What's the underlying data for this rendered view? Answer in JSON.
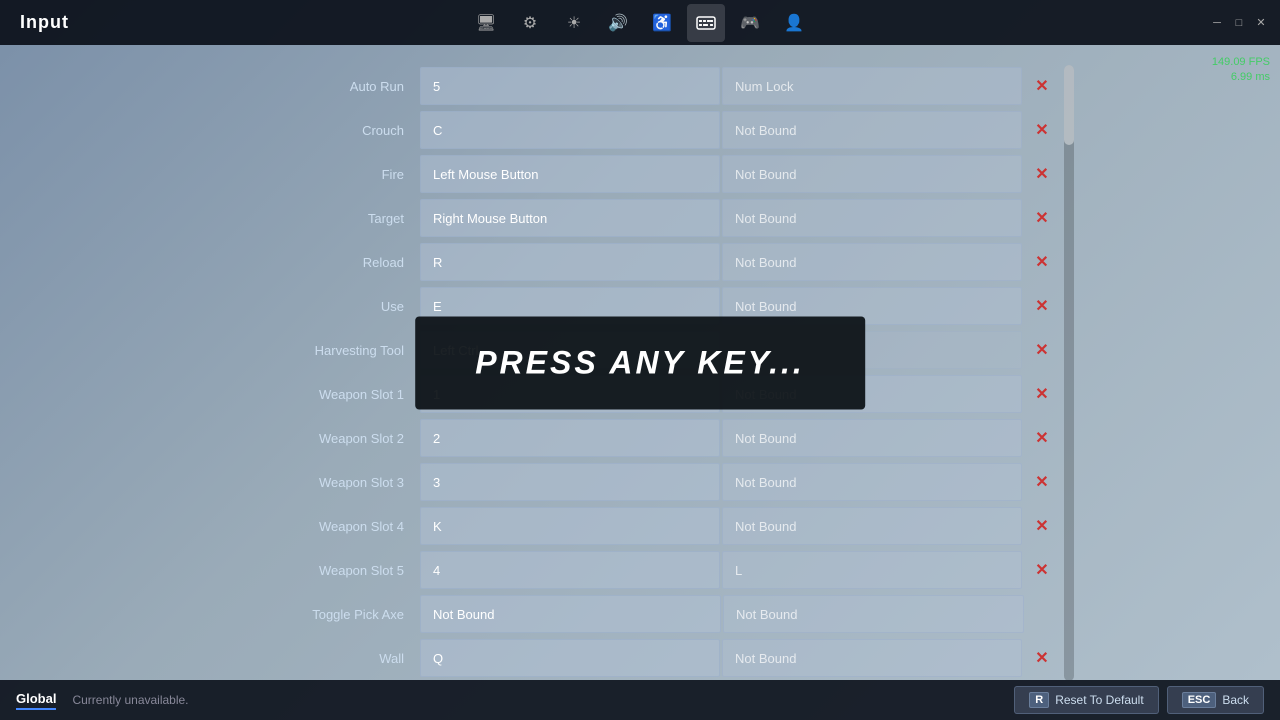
{
  "window": {
    "title": "Input",
    "fps": "149.09 FPS",
    "ms": "6.99 ms"
  },
  "nav_icons": [
    {
      "name": "display-icon",
      "symbol": "🖥",
      "active": false
    },
    {
      "name": "settings-icon",
      "symbol": "⚙",
      "active": false
    },
    {
      "name": "brightness-icon",
      "symbol": "☀",
      "active": false
    },
    {
      "name": "audio-icon",
      "symbol": "🔊",
      "active": false
    },
    {
      "name": "accessibility-icon",
      "symbol": "♿",
      "active": false
    },
    {
      "name": "input-icon",
      "symbol": "⌨",
      "active": true
    },
    {
      "name": "controller-icon",
      "symbol": "🎮",
      "active": false
    },
    {
      "name": "account-icon",
      "symbol": "👤",
      "active": false
    }
  ],
  "bindings": [
    {
      "action": "Auto Run",
      "primary": "5",
      "secondary": "Num Lock",
      "has_delete": true
    },
    {
      "action": "Crouch",
      "primary": "C",
      "secondary": "Not Bound",
      "has_delete": true
    },
    {
      "action": "Fire",
      "primary": "Left Mouse Button",
      "secondary": "Not Bound",
      "has_delete": true
    },
    {
      "action": "Target",
      "primary": "Right Mouse Button",
      "secondary": "Not Bound",
      "has_delete": true
    },
    {
      "action": "Reload",
      "primary": "R",
      "secondary": "Not Bound",
      "has_delete": true
    },
    {
      "action": "Use",
      "primary": "E",
      "secondary": "Not Bound",
      "has_delete": true
    },
    {
      "action": "Harvesting Tool",
      "primary": "Left Ctrl",
      "secondary": "",
      "has_delete": true
    },
    {
      "action": "Weapon Slot 1",
      "primary": "1",
      "secondary": "Not Bound",
      "has_delete": true
    },
    {
      "action": "Weapon Slot 2",
      "primary": "2",
      "secondary": "Not Bound",
      "has_delete": true
    },
    {
      "action": "Weapon Slot 3",
      "primary": "3",
      "secondary": "Not Bound",
      "has_delete": true
    },
    {
      "action": "Weapon Slot 4",
      "primary": "K",
      "secondary": "Not Bound",
      "has_delete": true
    },
    {
      "action": "Weapon Slot 5",
      "primary": "4",
      "secondary": "L",
      "has_delete": true
    },
    {
      "action": "Toggle Pick Axe",
      "primary": "Not Bound",
      "secondary": "Not Bound",
      "has_delete": false
    },
    {
      "action": "Wall",
      "primary": "Q",
      "secondary": "Not Bound",
      "has_delete": true
    }
  ],
  "press_any_key": "PRESS ANY KEY...",
  "bottom": {
    "tab_label": "Global",
    "status": "Currently unavailable.",
    "reset_key": "R",
    "reset_label": "Reset To Default",
    "back_key": "ESC",
    "back_label": "Back"
  }
}
